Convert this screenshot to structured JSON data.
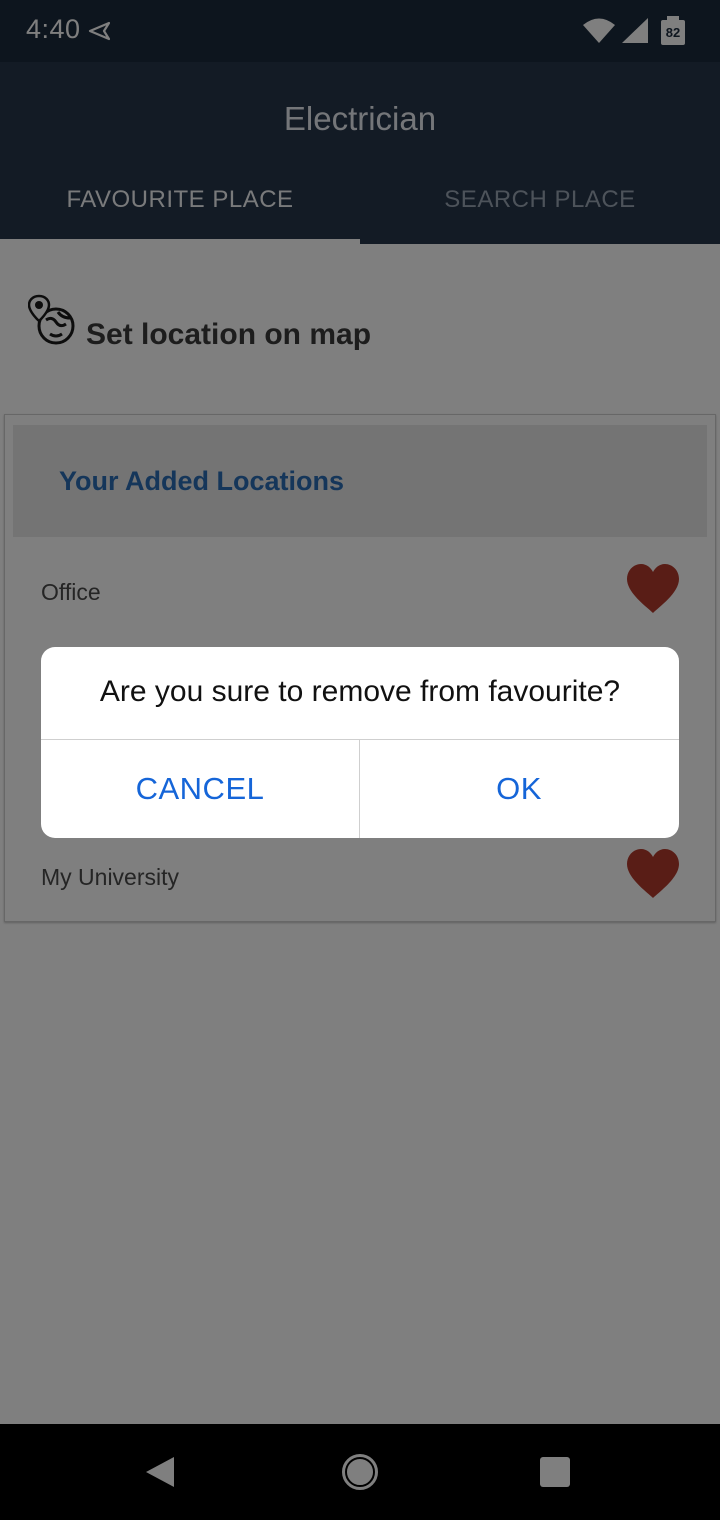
{
  "status_bar": {
    "time": "4:40",
    "battery": "82",
    "icons": [
      "navigation-arrow-icon",
      "wifi-icon",
      "signal-icon",
      "battery-icon"
    ]
  },
  "app_bar": {
    "title": "Electrician",
    "tabs": [
      {
        "label": "FAVOURITE PLACE",
        "selected": true
      },
      {
        "label": "SEARCH PLACE",
        "selected": false
      }
    ]
  },
  "content": {
    "set_location_label": "Set location on map",
    "set_location_icon": "globe-pin-icon",
    "card_header": "Your Added Locations",
    "locations": [
      {
        "name": "Office",
        "icon": "heart-icon"
      },
      {
        "name": "My University",
        "icon": "heart-icon"
      }
    ]
  },
  "dialog": {
    "message": "Are you sure to remove from favourite?",
    "cancel_label": "CANCEL",
    "ok_label": "OK"
  },
  "nav_bar": {
    "icons": [
      "back-icon",
      "home-icon",
      "recents-icon"
    ]
  },
  "colors": {
    "app_bar": "#26364b",
    "status_bar": "#1b2a3c",
    "accent_blue": "#2a6db5",
    "dialog_button": "#1565d8",
    "heart": "#b33a2c"
  }
}
